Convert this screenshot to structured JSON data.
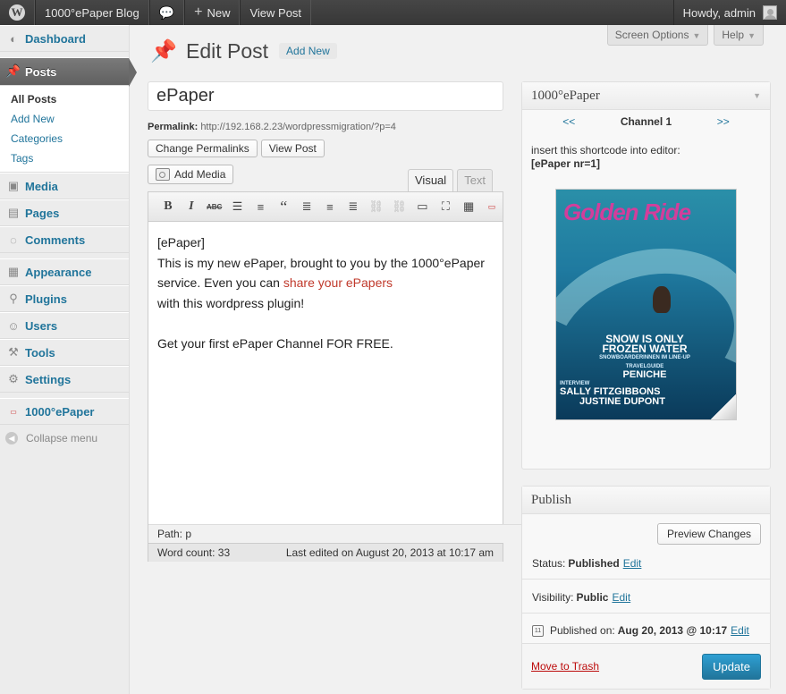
{
  "adminbar": {
    "site_name": "1000°ePaper Blog",
    "new_label": "New",
    "view_post": "View Post",
    "howdy": "Howdy, admin"
  },
  "sidebar": {
    "items": [
      {
        "label": "Dashboard",
        "icon": "dashboard-icon"
      },
      {
        "label": "Posts",
        "icon": "pin-icon"
      },
      {
        "label": "Media",
        "icon": "media-icon"
      },
      {
        "label": "Pages",
        "icon": "pages-icon"
      },
      {
        "label": "Comments",
        "icon": "comments-icon"
      },
      {
        "label": "Appearance",
        "icon": "appearance-icon"
      },
      {
        "label": "Plugins",
        "icon": "plugins-icon"
      },
      {
        "label": "Users",
        "icon": "users-icon"
      },
      {
        "label": "Tools",
        "icon": "tools-icon"
      },
      {
        "label": "Settings",
        "icon": "settings-icon"
      },
      {
        "label": "1000°ePaper",
        "icon": "epaper-icon"
      }
    ],
    "posts_submenu": [
      "All Posts",
      "Add New",
      "Categories",
      "Tags"
    ],
    "collapse": "Collapse menu"
  },
  "header": {
    "screen_options": "Screen Options",
    "help": "Help",
    "title": "Edit Post",
    "add_new": "Add New"
  },
  "post": {
    "title": "ePaper",
    "permalink_label": "Permalink:",
    "permalink_url": "http://192.168.2.23/wordpressmigration/?p=4",
    "change_permalinks": "Change Permalinks",
    "view_post": "View Post",
    "add_media": "Add Media",
    "tab_visual": "Visual",
    "tab_text": "Text",
    "body": {
      "line1": "[ePaper]",
      "line2": "This is my new ePaper, brought to you by the 1000°ePaper",
      "line3_pre": "service. Even you can ",
      "line3_link": "share your ePapers",
      "line4": "with this wordpress plugin!",
      "line5": "Get your first ePaper Channel FOR FREE."
    },
    "path": "Path: p",
    "word_count": "Word count: 33",
    "last_edited": "Last edited on August 20, 2013 at 10:17 am"
  },
  "epaper_box": {
    "title": "1000°ePaper",
    "prev": "<<",
    "channel": "Channel 1",
    "next": ">>",
    "instruction": "insert this shortcode into editor:",
    "shortcode": "[ePaper nr=1]",
    "cover": {
      "title": "Golden Ride",
      "line1": "SNOW IS ONLY",
      "line1b": "FROZEN WATER",
      "line2": "SNOWBOARDERINNEN IM LINE-UP",
      "line3": "TRAVELGUIDE",
      "line4": "PENICHE",
      "line5": "INTERVIEW",
      "line6": "SALLY FITZGIBBONS",
      "line7": "JUSTINE DUPONT"
    }
  },
  "publish": {
    "title": "Publish",
    "preview": "Preview Changes",
    "status_label": "Status:",
    "status_value": "Published",
    "visibility_label": "Visibility:",
    "visibility_value": "Public",
    "published_label": "Published on:",
    "published_value": "Aug 20, 2013 @ 10:17",
    "edit": "Edit",
    "calendar_day": "11",
    "trash": "Move to Trash",
    "update": "Update"
  },
  "colors": {
    "link": "#21759b",
    "accent_red": "#c0392b",
    "update_button": "#21759b"
  }
}
